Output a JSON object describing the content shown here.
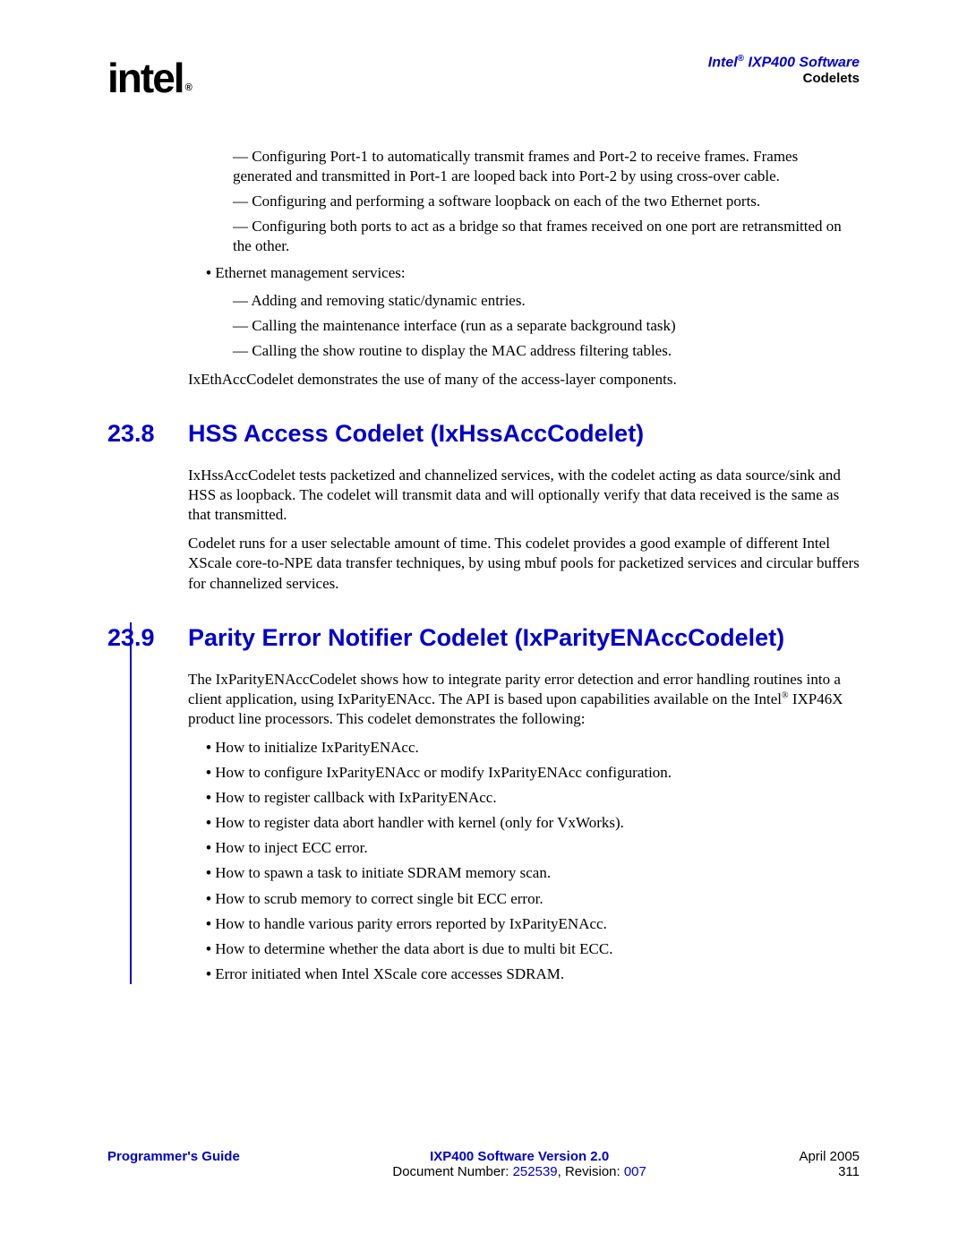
{
  "header": {
    "logo_text": "intel",
    "product_line1a": "Intel",
    "product_line1b": " IXP400 Software",
    "product_line2": "Codelets"
  },
  "top_dash_items": [
    "Configuring Port-1 to automatically transmit frames and Port-2 to receive frames. Frames generated and transmitted in Port-1 are looped back into Port-2 by using cross-over cable.",
    "Configuring and performing a software loopback on each of the two Ethernet ports.",
    "Configuring both ports to act as a bridge so that frames received on one port are retransmitted on the other."
  ],
  "eth_mgmt_label": "Ethernet management services:",
  "eth_mgmt_items": [
    "Adding and removing static/dynamic entries.",
    "Calling the maintenance interface (run as a separate background task)",
    "Calling the show routine to display the MAC address filtering tables."
  ],
  "eth_conclusion": "IxEthAccCodelet demonstrates the use of many of the access-layer components.",
  "section_238": {
    "num": "23.8",
    "title": "HSS Access Codelet (IxHssAccCodelet)",
    "p1": "IxHssAccCodelet tests packetized and channelized services, with the codelet acting as data source/sink and HSS as loopback. The codelet will transmit data and will optionally verify that data received is the same as that transmitted.",
    "p2": "Codelet runs for a user selectable amount of time. This codelet provides a good example of different Intel XScale core-to-NPE data transfer techniques, by using mbuf pools for packetized services and circular buffers for channelized services."
  },
  "section_239": {
    "num": "23.9",
    "title": "Parity Error Notifier Codelet (IxParityENAccCodelet)",
    "intro_a": "The IxParityENAccCodelet shows how to integrate parity error detection and error handling routines into a client application, using IxParityENAcc. The API is based upon capabilities available on the Intel",
    "intro_b": " IXP46X product line processors. This codelet demonstrates the following:",
    "bullets": [
      "How to initialize IxParityENAcc.",
      "How to configure IxParityENAcc or modify IxParityENAcc configuration.",
      "How to register callback with IxParityENAcc.",
      "How to register data abort handler with kernel (only for VxWorks).",
      "How to inject ECC error.",
      "How to spawn a task to initiate SDRAM memory scan.",
      "How to scrub memory to correct single bit ECC error.",
      "How to handle various parity errors reported by IxParityENAcc.",
      "How to determine whether the data abort is due to multi bit ECC.",
      "Error initiated when Intel XScale core accesses SDRAM."
    ]
  },
  "footer": {
    "left": "Programmer's Guide",
    "center_top": "IXP400 Software Version 2.0",
    "center_bottom_a": "Document Number: ",
    "center_bottom_b": "252539",
    "center_bottom_c": ", Revision: ",
    "center_bottom_d": "007",
    "right_top": "April 2005",
    "right_bottom": "311"
  }
}
